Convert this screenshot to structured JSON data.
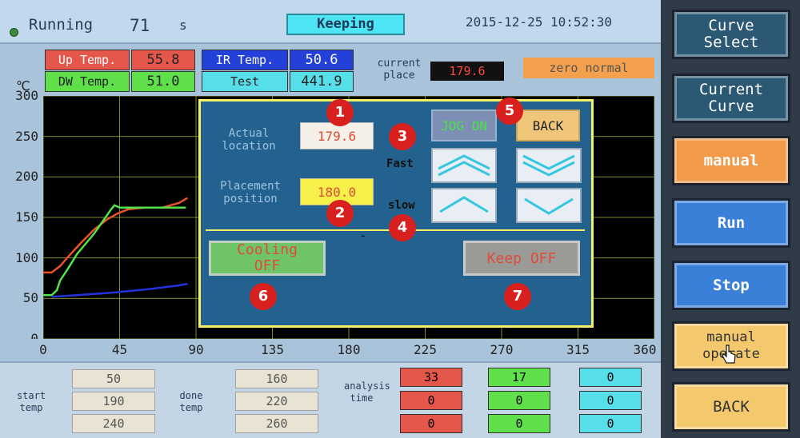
{
  "header": {
    "status": "Running",
    "elapsed": "71",
    "elapsed_unit": "s",
    "mode": "Keeping",
    "datetime": "2015-12-25 10:52:30"
  },
  "readings": {
    "up_label": "Up Temp.",
    "up_value": "55.8",
    "dw_label": "DW Temp.",
    "dw_value": "51.0",
    "ir_label": "IR Temp.",
    "ir_value": "50.6",
    "test_label": "Test",
    "test_value": "441.9",
    "current_place_label": "current place",
    "current_place_value": "179.6",
    "zero_status": "zero normal"
  },
  "chart_data": {
    "type": "line",
    "ylabel": "℃",
    "xlim": [
      0,
      360
    ],
    "ylim": [
      0,
      300
    ],
    "xticks": [
      "0",
      "45",
      "90",
      "135",
      "180",
      "225",
      "270",
      "315",
      "360"
    ],
    "yticks": [
      "300",
      "250",
      "200",
      "150",
      "100",
      "50",
      "0"
    ],
    "grid": true,
    "series": [
      {
        "color": "#e8532a",
        "x": [
          0,
          5,
          10,
          15,
          22,
          30,
          38,
          44,
          50,
          60,
          70,
          80,
          85
        ],
        "y": [
          82,
          82,
          90,
          102,
          118,
          135,
          148,
          155,
          160,
          162,
          162,
          168,
          174
        ]
      },
      {
        "color": "#55e34a",
        "x": [
          0,
          5,
          8,
          10,
          15,
          20,
          30,
          40,
          42,
          45,
          60,
          70,
          80,
          84
        ],
        "y": [
          54,
          54,
          60,
          72,
          88,
          105,
          130,
          160,
          165,
          162,
          162,
          162,
          162,
          162
        ]
      },
      {
        "color": "#2233dd",
        "x": [
          5,
          20,
          40,
          60,
          80,
          85
        ],
        "y": [
          52,
          54,
          57,
          61,
          66,
          68
        ]
      }
    ]
  },
  "panel": {
    "actual_label": "Actual location",
    "actual_value": "179.6",
    "placement_label": "Placement position",
    "placement_value": "180.0",
    "jog_label": "JOG ON",
    "back_label": "BACK",
    "fast_label": "Fast",
    "slow_label": "slow",
    "cooling_label": "Cooling OFF",
    "keep_label": "Keep OFF",
    "dash": "-"
  },
  "markers": [
    "1",
    "2",
    "3",
    "4",
    "5",
    "6",
    "7"
  ],
  "side": {
    "curve_select": "Curve Select",
    "current_curve": "Current Curve",
    "manual": "manual",
    "run": "Run",
    "stop": "Stop",
    "manual_operate": "manual operate",
    "back": "BACK"
  },
  "bottom": {
    "start_label": "start temp",
    "done_label": "done temp",
    "analysis_label": "analysis time",
    "start_values": [
      "50",
      "190",
      "240"
    ],
    "done_values": [
      "160",
      "220",
      "260"
    ],
    "red_values": [
      "33",
      "0",
      "0"
    ],
    "green_values": [
      "17",
      "0",
      "0"
    ],
    "cyan_values": [
      "0",
      "0",
      "0"
    ]
  }
}
